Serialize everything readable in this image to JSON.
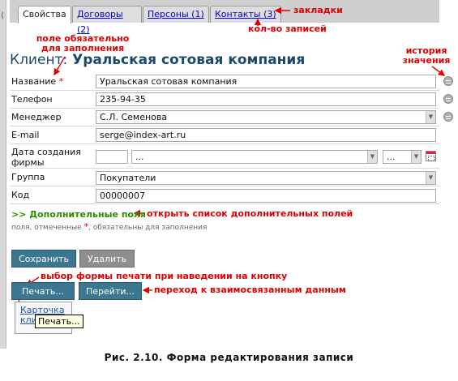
{
  "tabs": [
    {
      "label": "Свойства"
    },
    {
      "label": "Договоры (2)"
    },
    {
      "label": "Персоны (1)"
    },
    {
      "label": "Контакты (3)"
    }
  ],
  "annotations": {
    "tabs": "закладки",
    "record_count": "кол-во записей",
    "required_field": "поле обязательно для заполнения",
    "value_history": "история значения",
    "extra_fields": "открыть список дополнительных полей",
    "print_form": "выбор формы печати при наведении на кнопку",
    "related_data": "переход к взаимосвязанным данным"
  },
  "title": {
    "prefix": "Клиент:",
    "name": "Уральская сотовая компания"
  },
  "form": {
    "name": {
      "label": "Название",
      "required": "*",
      "value": "Уральская сотовая компания"
    },
    "phone": {
      "label": "Телефон",
      "value": "235-94-35"
    },
    "manager": {
      "label": "Менеджер",
      "value": "С.Л. Семенова"
    },
    "email": {
      "label": "E-mail",
      "value": "serge@index-art.ru"
    },
    "created": {
      "label_line1": "Дата создания",
      "label_line2": "фирмы",
      "day": "",
      "month": "...",
      "year": "..."
    },
    "group": {
      "label": "Группа",
      "value": "Покупатели"
    },
    "code": {
      "label": "Код",
      "value": "00000007"
    }
  },
  "extra_fields": {
    "label": ">> Дополнительные поля"
  },
  "required_hint": {
    "before": "поля, отмеченные ",
    "star": "*",
    "after": ", обязательны для заполнения"
  },
  "buttons": {
    "save": "Сохранить",
    "delete": "Удалить",
    "print": "Печать...",
    "goto": "Перейти..."
  },
  "print_menu": {
    "item": "Карточка клиента",
    "tooltip": "Печать..."
  },
  "caption": "Рис. 2.10. Форма редактирования записи",
  "colors": {
    "annotation": "#e00000",
    "title": "#1a4a6b",
    "button": "#3c7791",
    "link_green": "#2e8b00"
  }
}
